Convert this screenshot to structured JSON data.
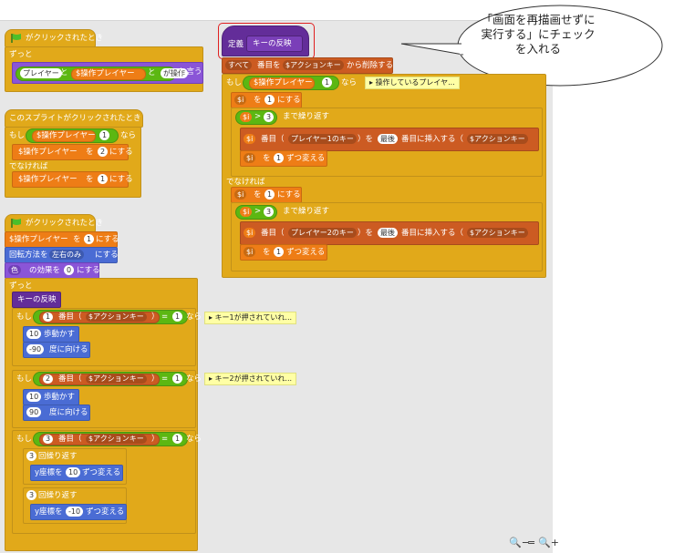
{
  "callout": {
    "line1": "「画面を再描画せずに",
    "line2": "実行する」にチェック",
    "line3": "を入れる"
  },
  "script1": {
    "hat": "がクリックされたとき",
    "forever": "ずっと",
    "join_a": "プレイヤー",
    "and1": "と",
    "var": "$操作プレイヤー",
    "and2": "と",
    "join_c": "が操作",
    "say": "と言う"
  },
  "script2": {
    "hat": "このスプライトがクリックされたとき",
    "if": "もし",
    "var": "$操作プレイヤー",
    "eq_val": "1",
    "then": "なら",
    "set_to": "を",
    "set_val": "2",
    "set_suffix": "にする",
    "else": "でなければ",
    "set_val2": "1"
  },
  "script3": {
    "hat": "がクリックされたとき",
    "set_var": "$操作プレイヤー",
    "set_to": "を",
    "set_val": "1",
    "set_suffix": "にする",
    "rot_prefix": "回転方法を",
    "rot_style": "左右のみ",
    "rot_suffix": "にする",
    "effect_name": "色",
    "effect_mid": "の効果を",
    "effect_val": "0",
    "effect_suffix": "にする",
    "forever": "ずっと",
    "call": "キーの反映",
    "if": "もし",
    "idx1": "1",
    "idx2": "2",
    "idx3": "3",
    "item_of": "番目（",
    "list": "$アクションキー",
    "close": "）",
    "eq": "=",
    "one": "1",
    "then": "なら",
    "comment1": "キー1が押されていれ...",
    "comment2": "キー2が押されていれ...",
    "move": "歩動かす",
    "move_val": "10",
    "point_val1": "-90",
    "point_val2": "90",
    "point_suffix": "度に向ける",
    "repeat": "回繰り返す",
    "repeat_val": "3",
    "change_y": "y座標を",
    "y_val1": "10",
    "y_val2": "-10",
    "change_suffix": "ずつ変える"
  },
  "script4": {
    "define": "定義",
    "proc_name": "キーの反映",
    "delete_all": "すべて",
    "delete_mid": "番目を",
    "delete_list": "$アクションキー",
    "delete_suffix": "から削除する",
    "if": "もし",
    "var": "$操作プレイヤー",
    "one": "1",
    "then": "なら",
    "comment": "操作しているプレイヤ...",
    "i": "$i",
    "set_to": "を",
    "set_val": "1",
    "set_suffix": "にする",
    "gt": ">",
    "three": "3",
    "until": "まで繰り返す",
    "item": "番目（",
    "list_p1": "プレイヤー1のキー",
    "list_p2": "プレイヤー2のキー",
    "close_wo": "）を",
    "last": "最後",
    "insert": "番目に挿入する（",
    "ins_list": "$アクションキー",
    "change_by": "ずつ変える",
    "else": "でなければ"
  },
  "zoom": {
    "zoom_out": "🔍−",
    "reset": "=",
    "zoom_in": "🔍+"
  },
  "colors": {
    "control": "#e1a91a",
    "variable": "#ee7d16",
    "list": "#cc5b22",
    "operator": "#5cb712",
    "motion": "#4a6cd4",
    "looks": "#8a55d7",
    "more_blocks": "#632d99",
    "comment": "#ffffa5",
    "highlight": "#e02020"
  }
}
